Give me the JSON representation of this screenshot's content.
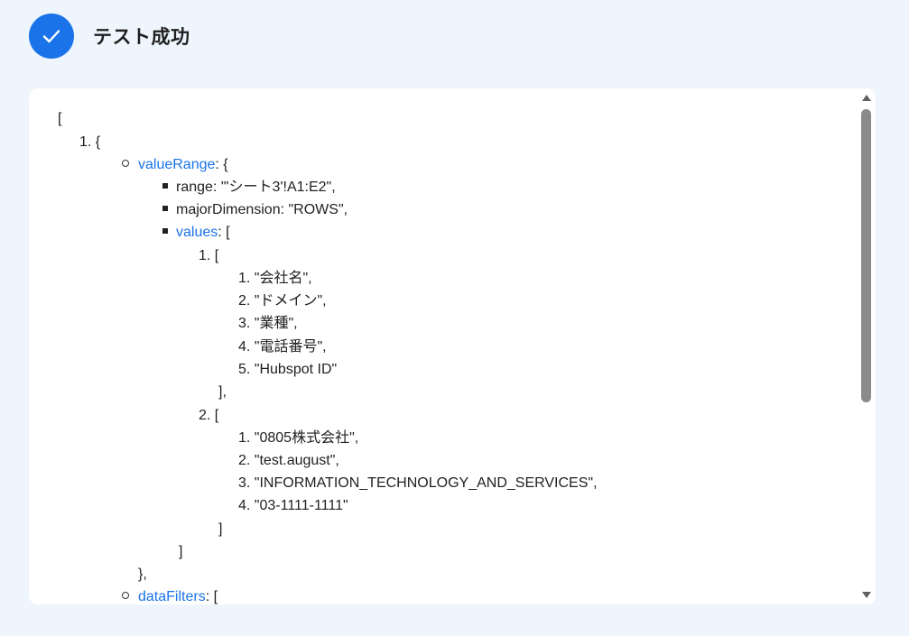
{
  "header": {
    "title": "テスト成功",
    "status_icon": "check-icon",
    "accent_color": "#1a73e8"
  },
  "output": {
    "open_bracket": "[",
    "item1_open": "1. {",
    "valueRange_key": "valueRange",
    "valueRange_suffix": ": {",
    "range_line": "range: \"'シート3'!A1:E2\",",
    "majorDimension_line": "majorDimension: \"ROWS\",",
    "values_key": "values",
    "values_suffix": ": [",
    "row1_open": "1. [",
    "row1": [
      "1. \"会社名\",",
      "2. \"ドメイン\",",
      "3. \"業種\",",
      "4. \"電話番号\",",
      "5. \"Hubspot ID\""
    ],
    "row1_close": "],",
    "row2_open": "2. [",
    "row2": [
      "1. \"0805株式会社\",",
      "2. \"test.august\",",
      "3. \"INFORMATION_TECHNOLOGY_AND_SERVICES\",",
      "4. \"03-1111-1111\""
    ],
    "row2_close": "]",
    "values_close": "]",
    "valueRange_close": "},",
    "dataFilters_key": "dataFilters",
    "dataFilters_suffix": ": ["
  }
}
